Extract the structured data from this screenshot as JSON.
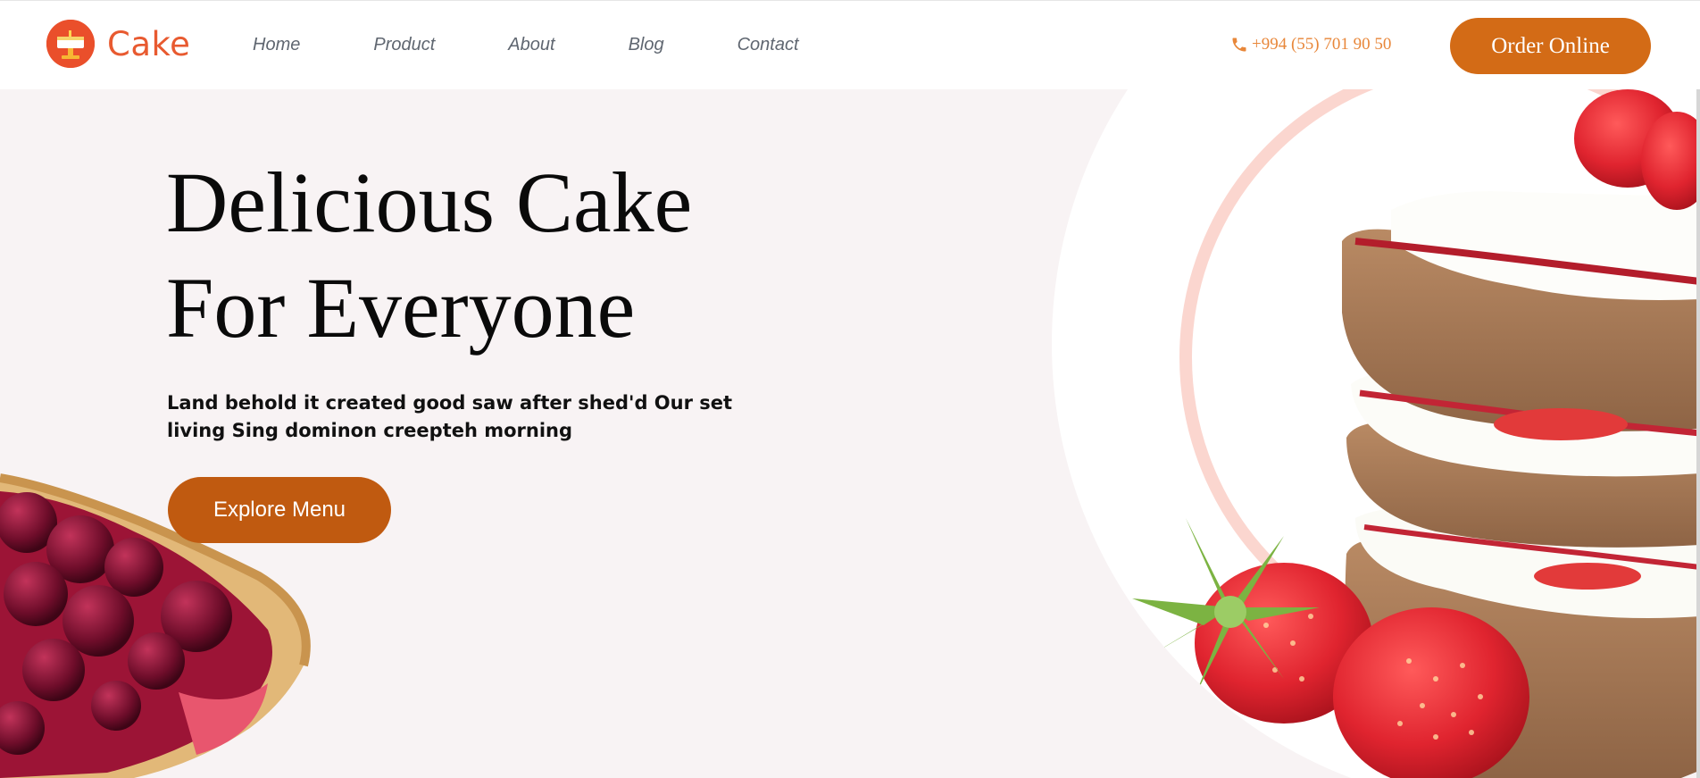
{
  "header": {
    "logo_text": "Cake",
    "nav": [
      {
        "label": "Home"
      },
      {
        "label": "Product"
      },
      {
        "label": "About"
      },
      {
        "label": "Blog"
      },
      {
        "label": "Contact"
      }
    ],
    "phone": "+994 (55) 701 90 50",
    "order_label": "Order Online"
  },
  "hero": {
    "title_line1": "Delicious Cake",
    "title_line2": "For Everyone",
    "subtitle": "Land behold it created good saw after shed'd Our set living Sing dominon creepteh morning",
    "cta_label": "Explore Menu"
  },
  "images": {
    "left": "cherry-tart-slice",
    "right": "strawberry-layer-cake"
  },
  "colors": {
    "brand": "#e85a30",
    "button": "#d36b16",
    "cta": "#c05a10",
    "hero_bg": "#f8f3f4",
    "phone": "#e8873a"
  }
}
